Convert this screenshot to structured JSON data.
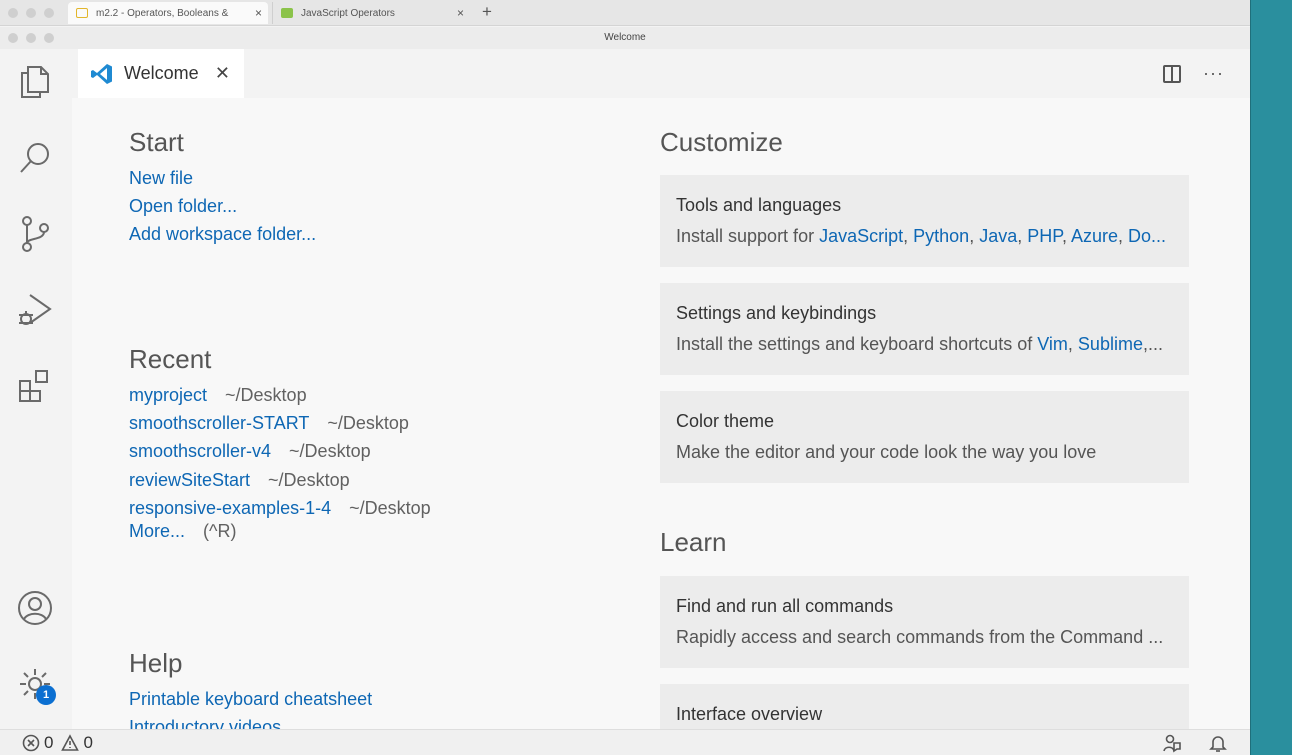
{
  "browser": {
    "tabs": [
      {
        "label": "m2.2 - Operators, Booleans &"
      },
      {
        "label": "JavaScript Operators"
      }
    ],
    "new_tab": "+",
    "close": "×"
  },
  "window": {
    "title": "Welcome"
  },
  "editor_tab": {
    "label": "Welcome",
    "close": "✕",
    "more": "···"
  },
  "start": {
    "title": "Start",
    "links": [
      "New file",
      "Open folder...",
      "Add workspace folder..."
    ]
  },
  "recent": {
    "title": "Recent",
    "items": [
      {
        "name": "myproject",
        "path": "~/Desktop"
      },
      {
        "name": "smoothscroller-START",
        "path": "~/Desktop"
      },
      {
        "name": "smoothscroller-v4",
        "path": "~/Desktop"
      },
      {
        "name": "reviewSiteStart",
        "path": "~/Desktop"
      },
      {
        "name": "responsive-examples-1-4",
        "path": "~/Desktop"
      }
    ],
    "more": "More...",
    "more_hint": "(^R)"
  },
  "help": {
    "title": "Help",
    "links": [
      "Printable keyboard cheatsheet",
      "Introductory videos"
    ]
  },
  "customize": {
    "title": "Customize",
    "cards": [
      {
        "title": "Tools and languages",
        "desc_prefix": "Install support for ",
        "desc_links": [
          "JavaScript",
          "Python",
          "Java",
          "PHP",
          "Azure",
          "Do..."
        ]
      },
      {
        "title": "Settings and keybindings",
        "desc_prefix": "Install the settings and keyboard shortcuts of ",
        "desc_links": [
          "Vim",
          "Sublime",
          "..."
        ]
      },
      {
        "title": "Color theme",
        "desc": "Make the editor and your code look the way you love"
      }
    ]
  },
  "learn": {
    "title": "Learn",
    "cards": [
      {
        "title": "Find and run all commands",
        "desc": "Rapidly access and search commands from the Command ..."
      },
      {
        "title": "Interface overview",
        "desc": ""
      }
    ]
  },
  "activity_bar": {
    "icons": [
      "explorer-icon",
      "search-icon",
      "source-control-icon",
      "run-debug-icon",
      "extensions-icon",
      "account-icon",
      "settings-gear-icon"
    ],
    "settings_badge": "1"
  },
  "status_bar": {
    "errors": "0",
    "warnings": "0"
  },
  "colors": {
    "link": "#0e67b4",
    "badge": "#0b6fd1",
    "teal_edge": "#2a8f9e"
  }
}
